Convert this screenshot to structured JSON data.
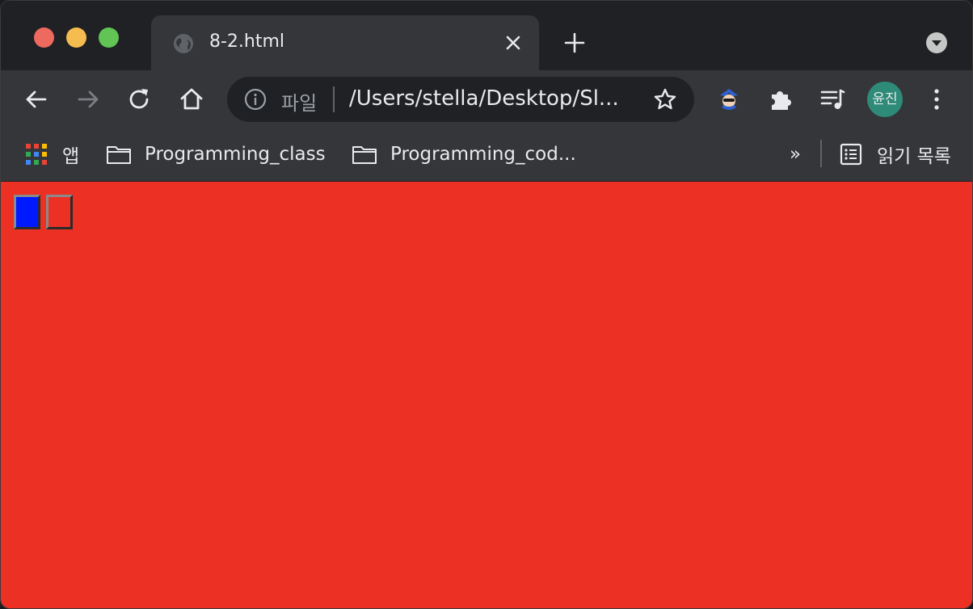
{
  "tab": {
    "title": "8-2.html"
  },
  "omnibox": {
    "scheme_label": "파일",
    "url": "/Users/stella/Desktop/Sl..."
  },
  "profile": {
    "initials": "윤진",
    "color": "#2e8b78"
  },
  "bookmarks": {
    "apps_label": "앱",
    "items": [
      {
        "label": "Programming_class"
      },
      {
        "label": "Programming_cod..."
      }
    ],
    "overflow_label": "»",
    "reading_list_label": "읽기 목록"
  },
  "page": {
    "background": "#ec3124",
    "buttons": [
      {
        "name": "blue",
        "color": "#0019ff"
      },
      {
        "name": "red",
        "color": "#ec3124"
      }
    ]
  }
}
